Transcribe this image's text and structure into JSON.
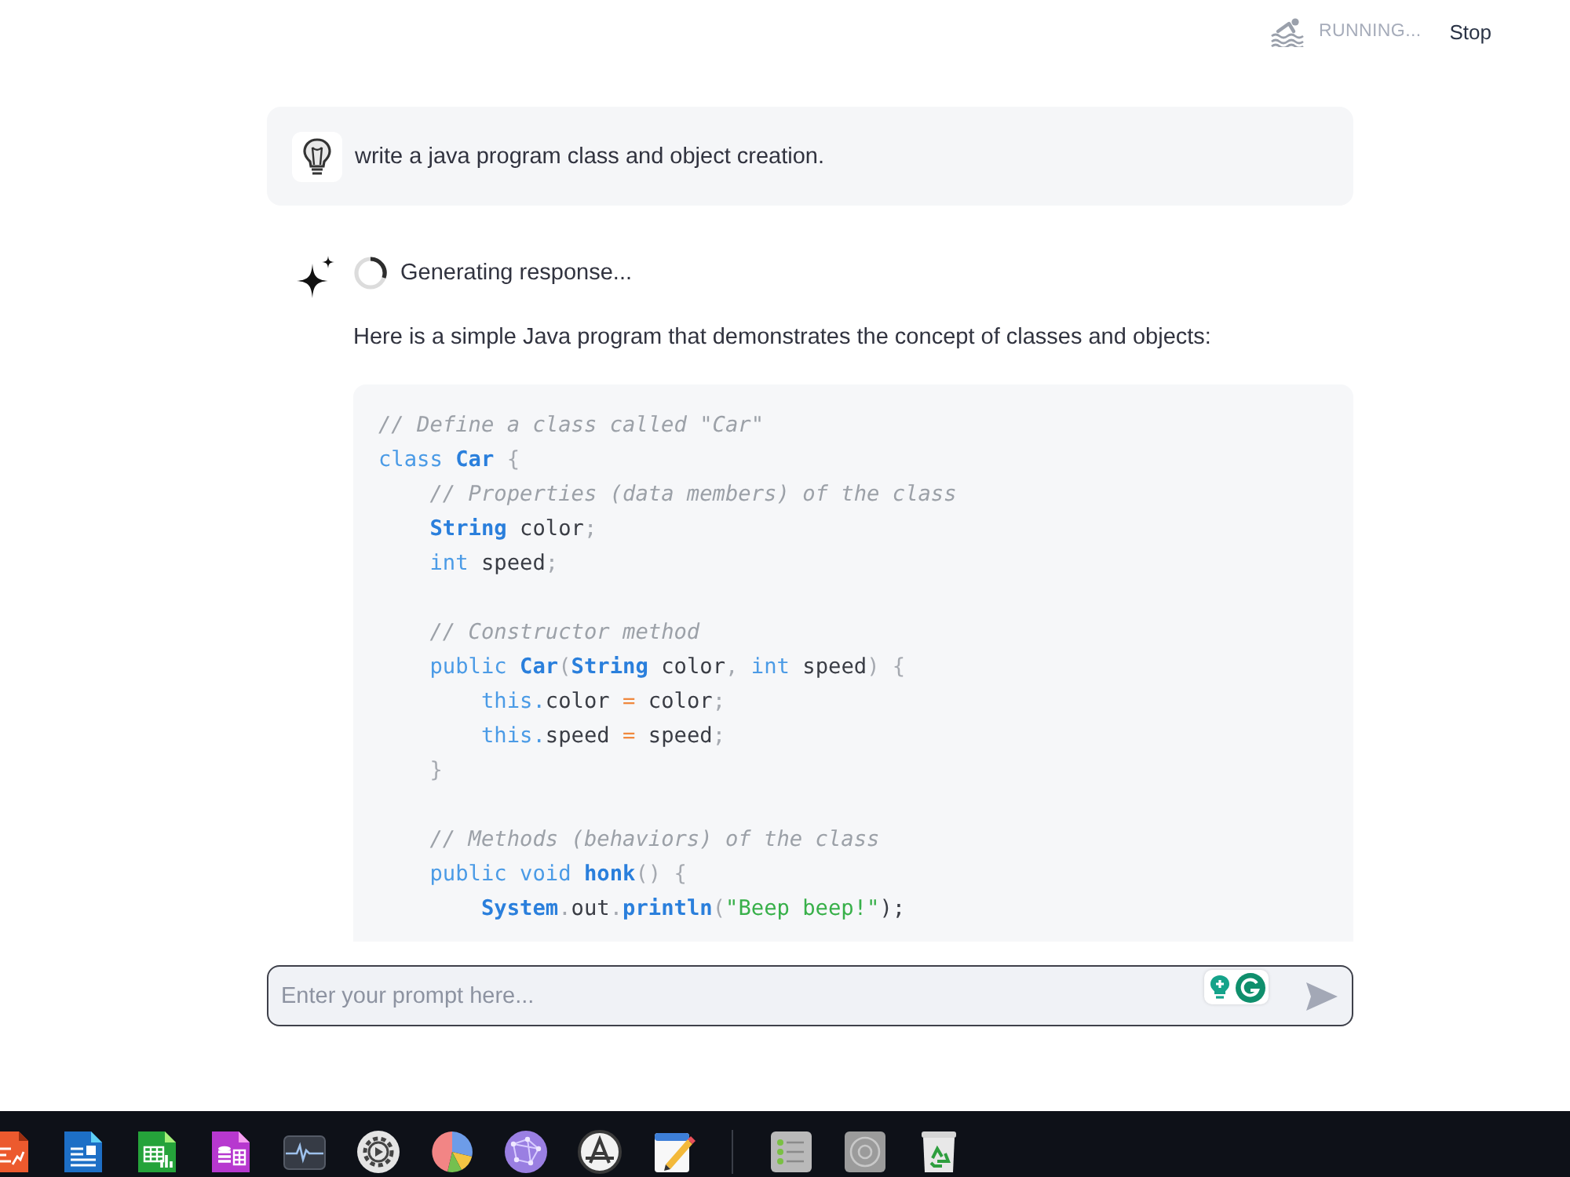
{
  "header": {
    "status": "RUNNING...",
    "stop_button": "Stop"
  },
  "messages": [
    {
      "kind": "user",
      "text": "write a java program class and object creation."
    },
    {
      "kind": "assistant",
      "status": "Generating response...",
      "text": "Here is a simple Java program that demonstrates the concept of classes and objects:",
      "code_lines": [
        {
          "kind": "code",
          "tokens": [
            {
              "kind": "comment",
              "text": "// Define a class called \"Car\""
            }
          ]
        },
        {
          "kind": "code",
          "tokens": [
            {
              "kind": "keyword",
              "text": "class"
            },
            {
              "kind": "name",
              "text": " Car"
            },
            {
              "kind": "punct",
              "text": " {"
            }
          ]
        },
        {
          "kind": "code",
          "tokens": [
            {
              "kind": "comment",
              "text": "    // Properties (data members) of the class"
            }
          ]
        },
        {
          "kind": "code",
          "tokens": [
            {
              "kind": "name",
              "text": "    String"
            },
            {
              "kind": "plain",
              "text": " color"
            },
            {
              "kind": "punct",
              "text": ";"
            }
          ]
        },
        {
          "kind": "code",
          "tokens": [
            {
              "kind": "keyword",
              "text": "    int"
            },
            {
              "kind": "plain",
              "text": " speed"
            },
            {
              "kind": "punct",
              "text": ";"
            }
          ]
        },
        {
          "kind": "blank"
        },
        {
          "kind": "code",
          "tokens": [
            {
              "kind": "comment",
              "text": "    // Constructor method"
            }
          ]
        },
        {
          "kind": "code",
          "tokens": [
            {
              "kind": "keyword",
              "text": "    public"
            },
            {
              "kind": "name",
              "text": " Car"
            },
            {
              "kind": "punct",
              "text": "("
            },
            {
              "kind": "name",
              "text": "String"
            },
            {
              "kind": "plain",
              "text": " color"
            },
            {
              "kind": "punct",
              "text": ", "
            },
            {
              "kind": "keyword",
              "text": "int"
            },
            {
              "kind": "plain",
              "text": " speed"
            },
            {
              "kind": "punct",
              "text": ") {"
            }
          ]
        },
        {
          "kind": "code",
          "tokens": [
            {
              "kind": "keyword",
              "text": "        this."
            },
            {
              "kind": "plain",
              "text": "color"
            },
            {
              "kind": "operator",
              "text": " = "
            },
            {
              "kind": "plain",
              "text": "color"
            },
            {
              "kind": "punct",
              "text": ";"
            }
          ]
        },
        {
          "kind": "code",
          "tokens": [
            {
              "kind": "keyword",
              "text": "        this."
            },
            {
              "kind": "plain",
              "text": "speed"
            },
            {
              "kind": "operator",
              "text": " = "
            },
            {
              "kind": "plain",
              "text": "speed"
            },
            {
              "kind": "punct",
              "text": ";"
            }
          ]
        },
        {
          "kind": "code",
          "tokens": [
            {
              "kind": "punct",
              "text": "    }"
            }
          ]
        },
        {
          "kind": "blank"
        },
        {
          "kind": "code",
          "tokens": [
            {
              "kind": "comment",
              "text": "    // Methods (behaviors) of the class"
            }
          ]
        },
        {
          "kind": "code",
          "tokens": [
            {
              "kind": "keyword",
              "text": "    public void"
            },
            {
              "kind": "name",
              "text": " honk"
            },
            {
              "kind": "punct",
              "text": "() {"
            }
          ]
        },
        {
          "kind": "code",
          "tokens": [
            {
              "kind": "name",
              "text": "        System"
            },
            {
              "kind": "punct",
              "text": "."
            },
            {
              "kind": "plain",
              "text": "out"
            },
            {
              "kind": "punct",
              "text": "."
            },
            {
              "kind": "name",
              "text": "println"
            },
            {
              "kind": "punct",
              "text": "("
            },
            {
              "kind": "string",
              "text": "\"Beep beep!\""
            },
            {
              "kind": "plain",
              "text": ");"
            }
          ]
        }
      ]
    }
  ],
  "prompt_input": {
    "placeholder": "Enter your prompt here..."
  }
}
